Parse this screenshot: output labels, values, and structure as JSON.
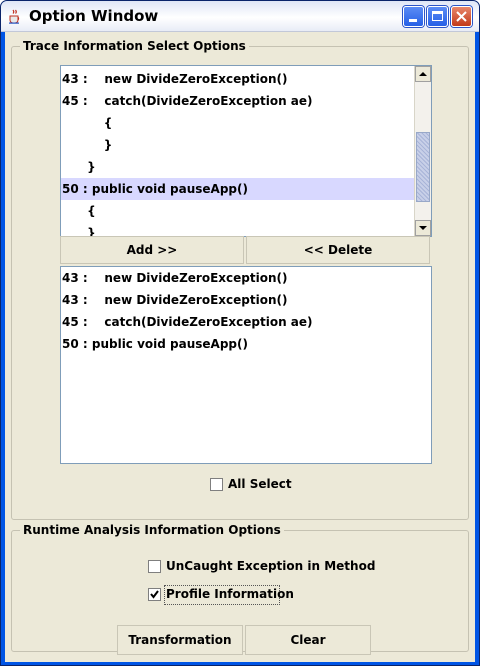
{
  "window": {
    "title": "Option Window",
    "icon": "java-cup-icon"
  },
  "trace_group": {
    "title": "Trace Information Select Options",
    "source_list": [
      {
        "text": "43 :    new DivideZeroException()",
        "selected": false
      },
      {
        "text": "45 :    catch(DivideZeroException ae)",
        "selected": false
      },
      {
        "text": "          {",
        "selected": false
      },
      {
        "text": "          }",
        "selected": false
      },
      {
        "text": "      }",
        "selected": false
      },
      {
        "text": "50 : public void pauseApp()",
        "selected": true
      },
      {
        "text": "      {",
        "selected": false
      },
      {
        "text": "      }",
        "selected": false
      }
    ],
    "add_label": "Add >>",
    "delete_label": "<< Delete",
    "selected_list": [
      "43 :    new DivideZeroException()",
      "43 :    new DivideZeroException()",
      "45 :    catch(DivideZeroException ae)",
      "50 : public void pauseApp()"
    ],
    "all_select": {
      "label": "All Select",
      "checked": false
    }
  },
  "runtime_group": {
    "title": "Runtime Analysis Information Options",
    "uncaught": {
      "label": "UnCaught Exception in Method",
      "checked": false
    },
    "profile": {
      "label": "Profile Information",
      "checked": true
    }
  },
  "footer": {
    "transformation_label": "Transformation",
    "clear_label": "Clear"
  },
  "colors": {
    "selection": "#d8d8ff",
    "titlebar": "#eef1f9",
    "panel": "#ece9d8"
  }
}
